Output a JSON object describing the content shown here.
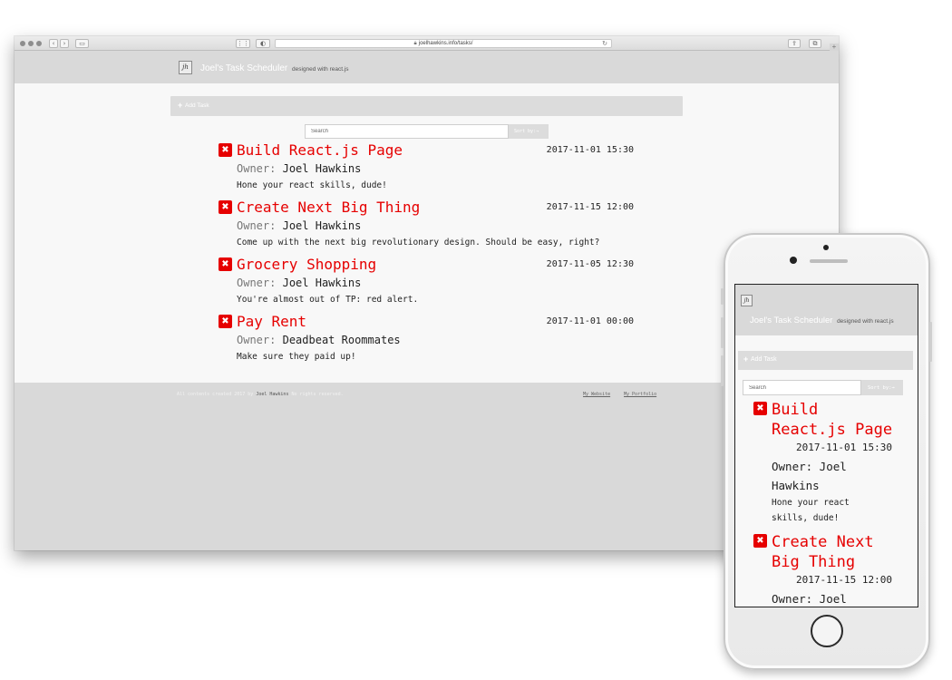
{
  "browser": {
    "url": "joelhawkins.info/tasks/"
  },
  "site": {
    "logo_text": "jh",
    "title": "Joel's Task Scheduler",
    "tagline": "designed with react.js",
    "add_task_label": "Add Task",
    "search_placeholder": "Search",
    "sort_label": "Sort by:→"
  },
  "tasks": [
    {
      "title": "Build React.js Page",
      "date": "2017-11-01 15:30",
      "owner_label": "Owner:",
      "owner": "Joel Hawkins",
      "description": "Hone your react skills, dude!"
    },
    {
      "title": "Create Next Big Thing",
      "date": "2017-11-15 12:00",
      "owner_label": "Owner:",
      "owner": "Joel Hawkins",
      "description": "Come up with the next big revolutionary design. Should be easy, right?"
    },
    {
      "title": "Grocery Shopping",
      "date": "2017-11-05 12:30",
      "owner_label": "Owner:",
      "owner": "Joel Hawkins",
      "description": "You're almost out of TP: red alert."
    },
    {
      "title": "Pay Rent",
      "date": "2017-11-01 00:00",
      "owner_label": "Owner:",
      "owner": "Deadbeat Roommates",
      "description": "Make sure they paid up!"
    }
  ],
  "footer": {
    "copyright_prefix": "All contents created 2017 by",
    "copyright_name": "Joel Hawkins",
    "copyright_suffix": "No rights reserved.",
    "link_website": "My Website",
    "link_portfolio": "My Portfolio"
  },
  "mobile": {
    "task1_title_l1": "Build",
    "task1_title_l2": "React.js Page",
    "task1_owner_l1": "Owner: Joel",
    "task1_owner_l2": "Hawkins",
    "task1_desc_l1": "Hone your react",
    "task1_desc_l2": "skills, dude!",
    "task2_title_l1": "Create Next",
    "task2_title_l2": "Big Thing",
    "task2_owner_l1": "Owner: Joel"
  },
  "colors": {
    "accent_red": "#e60000",
    "header_gray": "#d9d9d9",
    "content_bg": "#f8f8f8"
  },
  "icons": [
    "close-icon",
    "plus-icon",
    "lock-icon",
    "reload-icon"
  ]
}
